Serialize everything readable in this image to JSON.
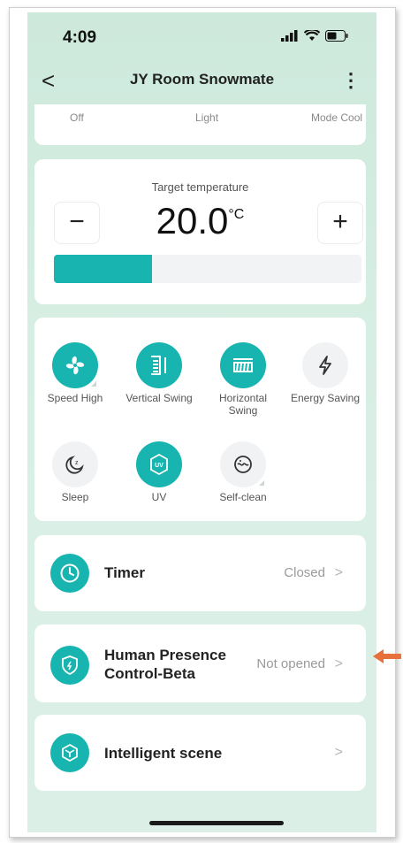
{
  "status_bar": {
    "time": "4:09"
  },
  "nav": {
    "back": "<",
    "title": "JY Room Snowmate",
    "more": "⋮"
  },
  "modes": {
    "off": "Off",
    "light": "Light",
    "mode": "Mode Cool"
  },
  "temperature": {
    "label": "Target temperature",
    "value": "20.0",
    "unit": "°C",
    "minus": "−",
    "plus": "+",
    "level": 0.32
  },
  "functions": [
    {
      "label": "Speed High",
      "active": true,
      "icon": "fan-icon"
    },
    {
      "label": "Vertical Swing",
      "active": true,
      "icon": "vertical-swing-icon"
    },
    {
      "label": "Horizontal Swing",
      "active": true,
      "icon": "horizontal-swing-icon"
    },
    {
      "label": "Energy Saving",
      "active": false,
      "icon": "lightning-icon"
    },
    {
      "label": "Sleep",
      "active": false,
      "icon": "moon-icon"
    },
    {
      "label": "UV",
      "active": true,
      "icon": "uv-icon"
    },
    {
      "label": "Self-clean",
      "active": false,
      "icon": "self-clean-icon"
    }
  ],
  "timer": {
    "label": "Timer",
    "status": "Closed",
    "icon": "clock-icon"
  },
  "presence": {
    "label_line1": "Human Presence",
    "label_line2": "Control-Beta",
    "status": "Not opened",
    "icon": "shield-icon"
  },
  "scene": {
    "label": "Intelligent scene",
    "icon": "cube-icon"
  },
  "colors": {
    "accent": "#17b4b0",
    "background": "#d4ece1",
    "arrow": "#e8703a"
  }
}
